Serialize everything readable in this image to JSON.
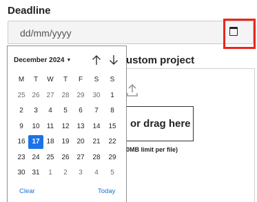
{
  "form": {
    "deadline_label": "Deadline",
    "date_placeholder": "dd/mm/yyyy",
    "behind_heading": "ustom project",
    "drag_text": "or drag here",
    "limit_text": "0MB limit per file)"
  },
  "calendar": {
    "month_label": "December 2024",
    "weekdays": [
      "M",
      "T",
      "W",
      "T",
      "F",
      "S",
      "S"
    ],
    "weeks": [
      [
        "25",
        "26",
        "27",
        "28",
        "29",
        "30",
        "1"
      ],
      [
        "2",
        "3",
        "4",
        "5",
        "6",
        "7",
        "8"
      ],
      [
        "9",
        "10",
        "11",
        "12",
        "13",
        "14",
        "15"
      ],
      [
        "16",
        "17",
        "18",
        "19",
        "20",
        "21",
        "22"
      ],
      [
        "23",
        "24",
        "25",
        "26",
        "27",
        "28",
        "29"
      ],
      [
        "30",
        "31",
        "1",
        "2",
        "3",
        "4",
        "5"
      ]
    ],
    "selected_day": "17",
    "clear_label": "Clear",
    "today_label": "Today"
  },
  "icons": {
    "calendar_picker": "calendar-icon",
    "prev_month": "arrow-up-icon",
    "next_month": "arrow-down-icon",
    "upload": "upload-arrow-icon"
  },
  "colors": {
    "accent": "#1c73e8",
    "highlight": "#e8261c",
    "link": "#1a6fd6"
  }
}
